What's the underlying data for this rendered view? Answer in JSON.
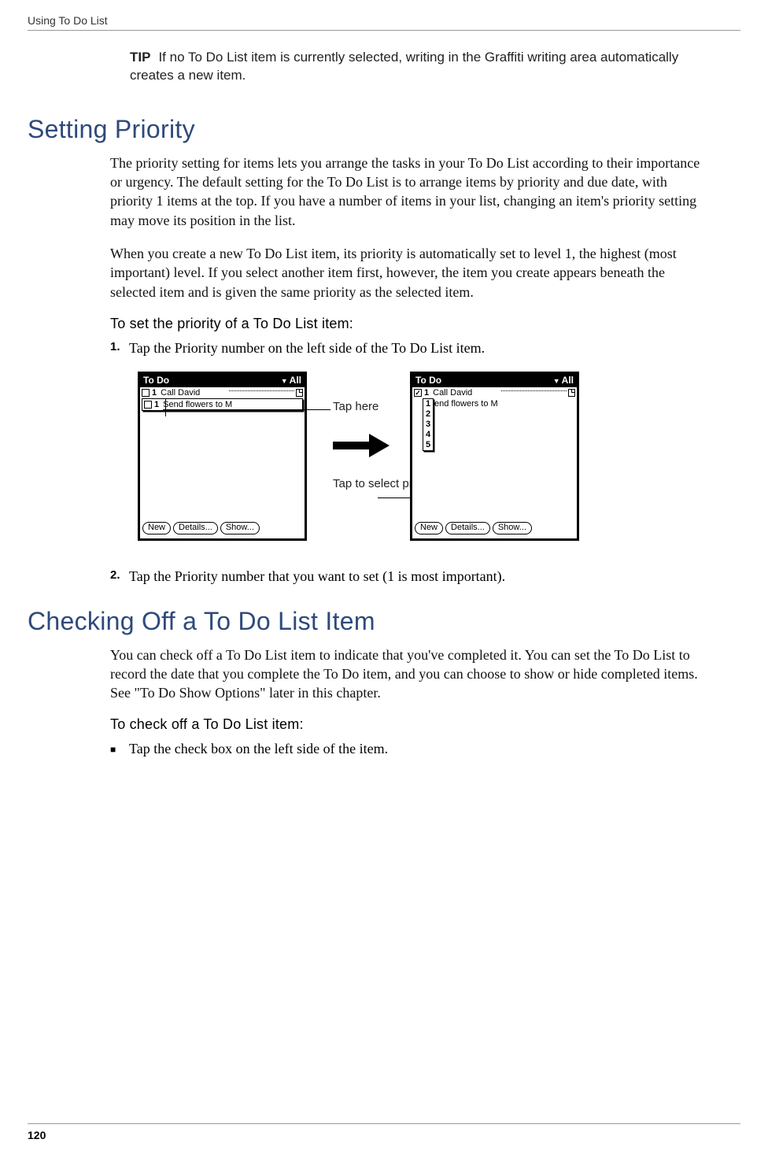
{
  "header": "Using To Do List",
  "page_number": "120",
  "tip": {
    "label": "TIP",
    "text": "If no To Do List item is currently selected, writing in the Graffiti writing area automatically creates a new item."
  },
  "section1": {
    "heading": "Setting Priority",
    "para1": "The priority setting for items lets you arrange the tasks in your To Do List according to their importance or urgency. The default setting for the To Do List is to arrange items by priority and due date, with priority 1 items at the top. If you have a number of items in your list, changing an item's priority setting may move its position in the list.",
    "para2": "When you create a new To Do List item, its priority is automatically set to level 1, the highest (most important) level. If you select another item first, however, the item you create appears beneath the selected item and is given the same priority as the selected item.",
    "subheading": "To set the priority of a To Do List item:",
    "step1": "Tap the Priority number on the left side of the To Do List item.",
    "step2": "Tap the Priority number that you want to set (1 is most important)."
  },
  "section2": {
    "heading": "Checking Off a To Do List Item",
    "para1": "You can check off a To Do List item to indicate that you've completed it. You can set the To Do List to record the date that you complete the To Do item, and you can choose to show or hide completed items. See \"To Do Show Options\" later in this chapter.",
    "subheading": "To check off a To Do List item:",
    "bullet1": "Tap the check box on the left side of the item."
  },
  "figure": {
    "app_title": "To Do",
    "category": "All",
    "item1_priority": "1",
    "item1_text": "Call David",
    "item2_priority": "1",
    "item2_text_left": "Send flowers to M",
    "item2_text_right": "end flowers to M",
    "btn_new": "New",
    "btn_details": "Details...",
    "btn_show": "Show...",
    "ann_taphere": "Tap here",
    "ann_tapselect": "Tap to select priority",
    "popup": [
      "1",
      "2",
      "3",
      "4",
      "5"
    ]
  }
}
